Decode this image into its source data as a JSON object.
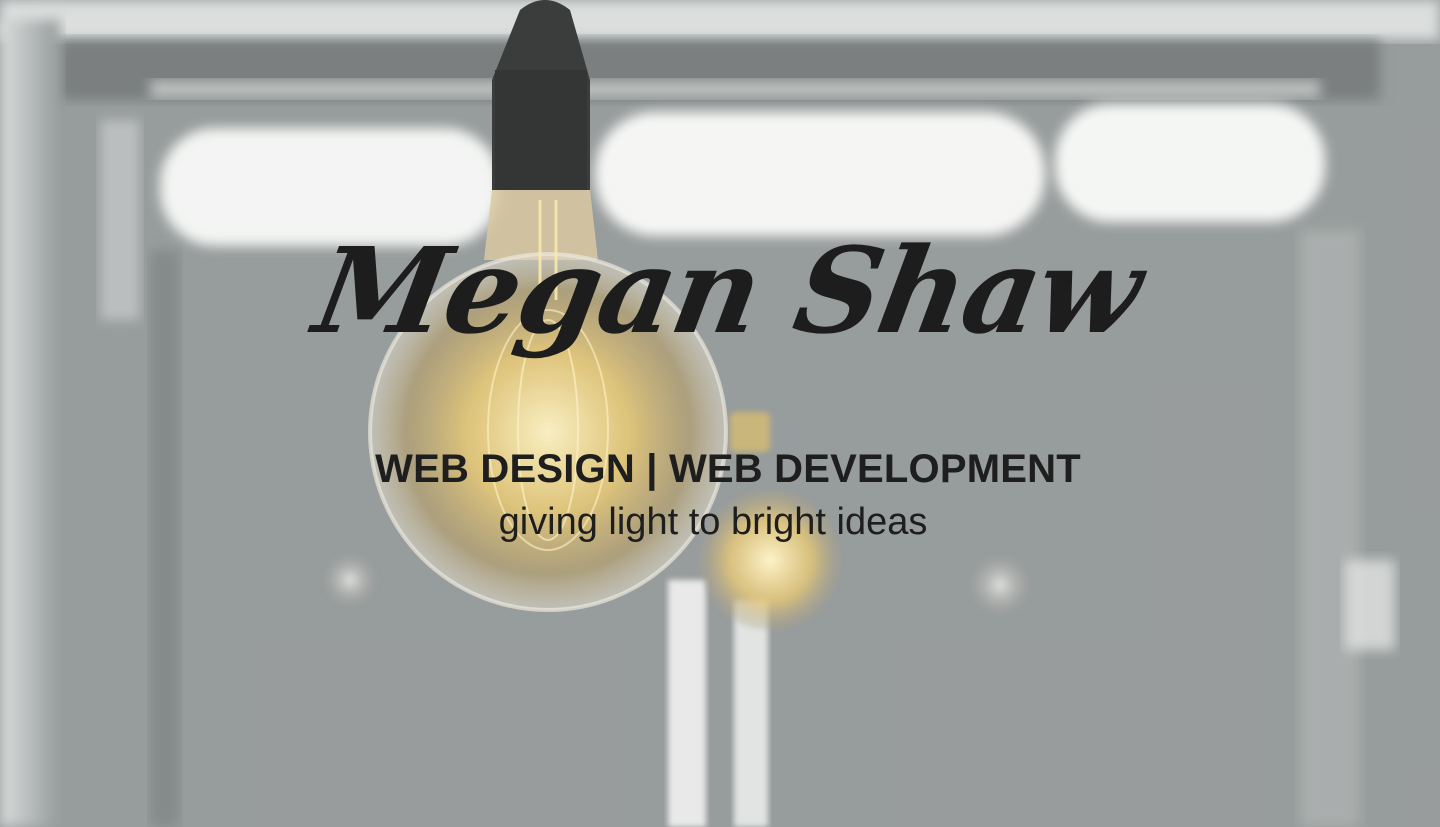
{
  "hero": {
    "name": "Megan Shaw",
    "services": "WEB DESIGN | WEB DEVELOPMENT",
    "slogan": "giving light to bright ideas"
  },
  "colors": {
    "background": "#8c9191",
    "text": "#1e1e1e",
    "bulb_glow": "#f3d77a"
  },
  "icons": {
    "background_image": "lightbulb-photo"
  }
}
